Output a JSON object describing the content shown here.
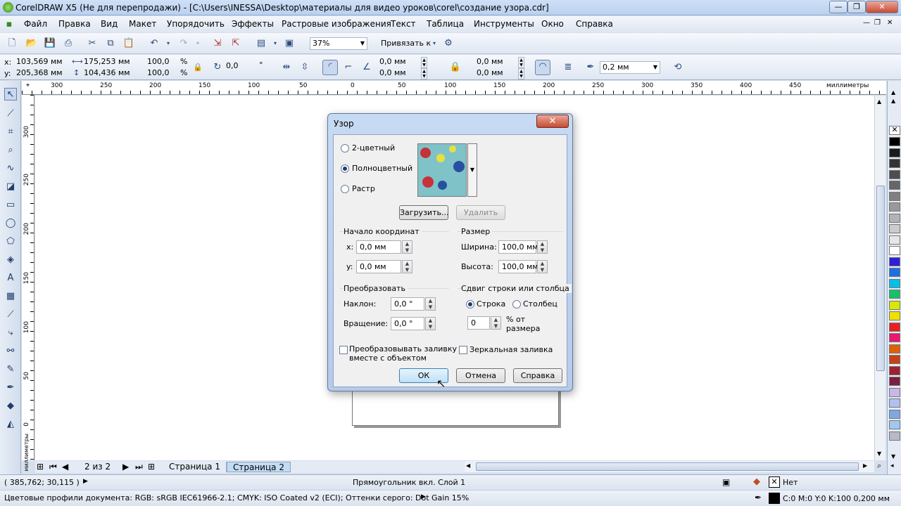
{
  "window": {
    "title": "CorelDRAW X5 (Не для перепродажи) - [C:\\Users\\INESSA\\Desktop\\материалы для видео уроков\\corel\\создание узора.cdr]"
  },
  "menu": [
    "Файл",
    "Правка",
    "Вид",
    "Макет",
    "Упорядочить",
    "Эффекты",
    "Растровые изображения",
    "Текст",
    "Таблица",
    "Инструменты",
    "Окно",
    "Справка"
  ],
  "toolbar": {
    "zoom": "37%",
    "snap": "Привязать к"
  },
  "propbar": {
    "x_label": "x:",
    "x": "103,569 мм",
    "y_label": "y:",
    "y": "205,368 мм",
    "w": "175,253 мм",
    "h": "104,436 мм",
    "sx": "100,0",
    "sy": "100,0",
    "pct": "%",
    "angle": "0,0",
    "deg": "°",
    "c1": "0,0 мм",
    "c2": "0,0 мм",
    "c3": "0,0 мм",
    "c4": "0,0 мм",
    "outline": "0,2 мм"
  },
  "ruler": {
    "h_ticks": [
      "300",
      "250",
      "200",
      "150",
      "100",
      "50",
      "0",
      "50",
      "100",
      "150",
      "200",
      "250",
      "300",
      "350",
      "400",
      "450"
    ],
    "units": "миллиметры",
    "v_ticks": [
      "300",
      "250",
      "200",
      "150",
      "100",
      "50",
      "0"
    ],
    "v_units": "миллиметры"
  },
  "pages": {
    "counter": "2 из 2",
    "tabs": [
      "Страница 1",
      "Страница 2"
    ]
  },
  "status": {
    "coords": "( 385,762; 30,115 )",
    "object": "Прямоугольник вкл. Слой 1",
    "fill": "Нет",
    "profiles": "Цветовые профили документа: RGB: sRGB IEC61966-2.1; CMYK: ISO Coated v2 (ECI); Оттенки серого: Dot Gain 15%",
    "outline": "C:0 M:0 Y:0 K:100  0,200 мм"
  },
  "dialog": {
    "title": "Узор",
    "close": "✕",
    "radio_2color": "2-цветный",
    "radio_full": "Полноцветный",
    "radio_bitmap": "Растр",
    "load": "Загрузить...",
    "delete": "Удалить",
    "origin_title": "Начало координат",
    "ox_label": "x:",
    "ox": "0,0 мм",
    "oy_label": "y:",
    "oy": "0,0 мм",
    "size_title": "Размер",
    "width_label": "Ширина:",
    "width": "100,0 мм",
    "height_label": "Высота:",
    "height": "100,0 мм",
    "transform_title": "Преобразовать",
    "skew_label": "Наклон:",
    "skew": "0,0 °",
    "rot_label": "Вращение:",
    "rot": "0,0 °",
    "offset_title": "Сдвиг строки или столбца",
    "row": "Строка",
    "column": "Столбец",
    "offset_value": "0",
    "offset_unit_1": "% от",
    "offset_unit_2": "размера",
    "transform_fill_1": "Преобразовывать заливку",
    "transform_fill_2": "вместе с объектом",
    "mirror_fill": "Зеркальная заливка",
    "ok": "ОК",
    "cancel": "Отмена",
    "help": "Справка"
  },
  "palette_colors": [
    "#000000",
    "#1a1a1a",
    "#333333",
    "#4d4d4d",
    "#666666",
    "#808080",
    "#999999",
    "#b3b3b3",
    "#cccccc",
    "#e6e6e6",
    "#ffffff",
    "#2e1fd6",
    "#1f6fe0",
    "#00c0e8",
    "#18c06a",
    "#d8e800",
    "#f0e000",
    "#e82020",
    "#e8186e",
    "#e06000",
    "#c84018",
    "#a02030",
    "#7a1f40",
    "#c8b8e8",
    "#b0c0f0",
    "#80a8e0",
    "#a0c8f0",
    "#b8b8c8"
  ],
  "colors": {
    "accent": "#3c7fb1"
  }
}
